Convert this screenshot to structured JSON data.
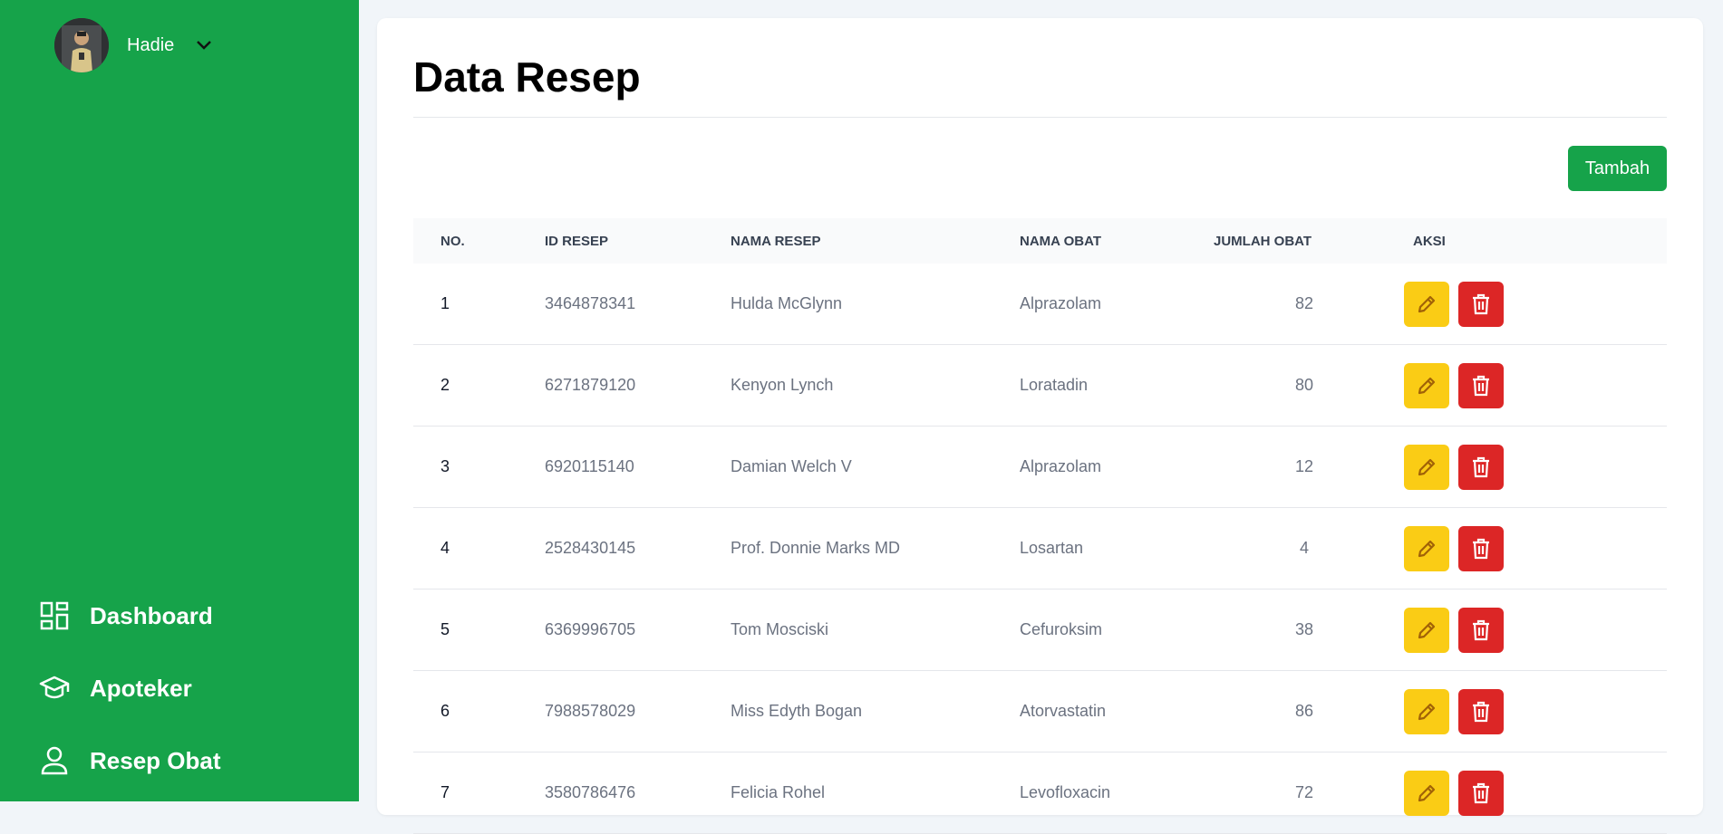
{
  "user": {
    "name": "Hadie"
  },
  "nav": [
    {
      "label": "Dashboard",
      "icon": "dashboard-icon"
    },
    {
      "label": "Apoteker",
      "icon": "graduation-cap-icon"
    },
    {
      "label": "Resep Obat",
      "icon": "user-icon"
    }
  ],
  "page": {
    "title": "Data Resep",
    "add_label": "Tambah"
  },
  "table": {
    "headers": [
      "NO.",
      "ID RESEP",
      "NAMA RESEP",
      "NAMA OBAT",
      "JUMLAH OBAT",
      "AKSI"
    ],
    "rows": [
      {
        "no": "1",
        "id": "3464878341",
        "nama_resep": "Hulda McGlynn",
        "nama_obat": "Alprazolam",
        "jumlah": "82"
      },
      {
        "no": "2",
        "id": "6271879120",
        "nama_resep": "Kenyon Lynch",
        "nama_obat": "Loratadin",
        "jumlah": "80"
      },
      {
        "no": "3",
        "id": "6920115140",
        "nama_resep": "Damian Welch V",
        "nama_obat": "Alprazolam",
        "jumlah": "12"
      },
      {
        "no": "4",
        "id": "2528430145",
        "nama_resep": "Prof. Donnie Marks MD",
        "nama_obat": "Losartan",
        "jumlah": "4"
      },
      {
        "no": "5",
        "id": "6369996705",
        "nama_resep": "Tom Mosciski",
        "nama_obat": "Cefuroksim",
        "jumlah": "38"
      },
      {
        "no": "6",
        "id": "7988578029",
        "nama_resep": "Miss Edyth Bogan",
        "nama_obat": "Atorvastatin",
        "jumlah": "86"
      },
      {
        "no": "7",
        "id": "3580786476",
        "nama_resep": "Felicia Rohel",
        "nama_obat": "Levofloxacin",
        "jumlah": "72"
      }
    ]
  },
  "colors": {
    "primary": "#16a34a",
    "edit": "#facc15",
    "delete": "#dc2626"
  }
}
